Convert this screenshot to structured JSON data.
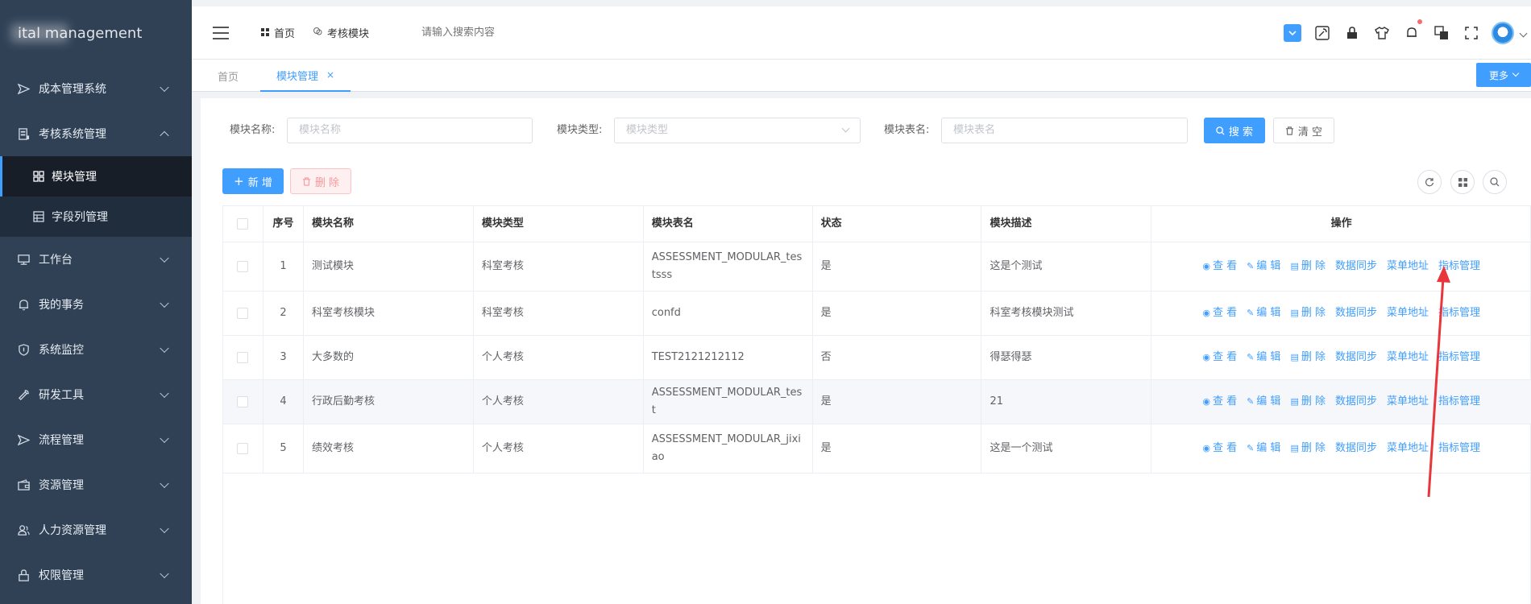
{
  "sidebar": {
    "logo_text": "ital management",
    "menu": [
      {
        "label": "成本管理系统",
        "icon": "send-icon"
      },
      {
        "label": "考核系统管理",
        "icon": "server-icon",
        "expanded": true
      },
      {
        "label": "工作台",
        "icon": "monitor-icon"
      },
      {
        "label": "我的事务",
        "icon": "bell-icon"
      },
      {
        "label": "系统监控",
        "icon": "shield-icon"
      },
      {
        "label": "研发工具",
        "icon": "wrench-icon"
      },
      {
        "label": "流程管理",
        "icon": "send-icon"
      },
      {
        "label": "资源管理",
        "icon": "wallet-icon"
      },
      {
        "label": "人力资源管理",
        "icon": "users-icon"
      },
      {
        "label": "权限管理",
        "icon": "lock-icon"
      }
    ],
    "sub_items": [
      {
        "label": "模块管理",
        "icon": "grid-icon",
        "active": true
      },
      {
        "label": "字段列管理",
        "icon": "table-icon"
      }
    ]
  },
  "topbar": {
    "home": "首页",
    "module": "考核模块",
    "search_placeholder": "请输入搜索内容"
  },
  "tags": {
    "home": "首页",
    "active": "模块管理",
    "more": "更多"
  },
  "search_form": {
    "name_label": "模块名称:",
    "name_placeholder": "模块名称",
    "type_label": "模块类型:",
    "type_placeholder": "模块类型",
    "table_label": "模块表名:",
    "table_placeholder": "模块表名",
    "search_btn": "搜 索",
    "clear_btn": "清 空"
  },
  "toolbar": {
    "add_btn": "新 增",
    "delete_btn": "删 除"
  },
  "table": {
    "headers": [
      "序号",
      "模块名称",
      "模块类型",
      "模块表名",
      "状态",
      "模块描述",
      "操作"
    ],
    "rows": [
      {
        "no": "1",
        "name": "测试模块",
        "type": "科室考核",
        "table": "ASSESSMENT_MODULAR_testsss",
        "status": "是",
        "desc": "这是个测试"
      },
      {
        "no": "2",
        "name": "科室考核模块",
        "type": "科室考核",
        "table": "confd",
        "status": "是",
        "desc": "科室考核模块测试"
      },
      {
        "no": "3",
        "name": "大多数的",
        "type": "个人考核",
        "table": "TEST2121212112",
        "status": "否",
        "desc": "得瑟得瑟"
      },
      {
        "no": "4",
        "name": "行政后勤考核",
        "type": "个人考核",
        "table": "ASSESSMENT_MODULAR_test",
        "status": "是",
        "desc": "21"
      },
      {
        "no": "5",
        "name": "绩效考核",
        "type": "个人考核",
        "table": "ASSESSMENT_MODULAR_jixiao",
        "status": "是",
        "desc": "这是一个测试"
      }
    ],
    "ops": {
      "view": "查 看",
      "edit": "编 辑",
      "delete": "删 除",
      "sync": "数据同步",
      "menu": "菜单地址",
      "index": "指标管理"
    }
  },
  "colors": {
    "sidebar_bg": "#304156",
    "primary": "#409eff",
    "danger_light": "#fef0f0",
    "annotation": "#e8363a"
  }
}
